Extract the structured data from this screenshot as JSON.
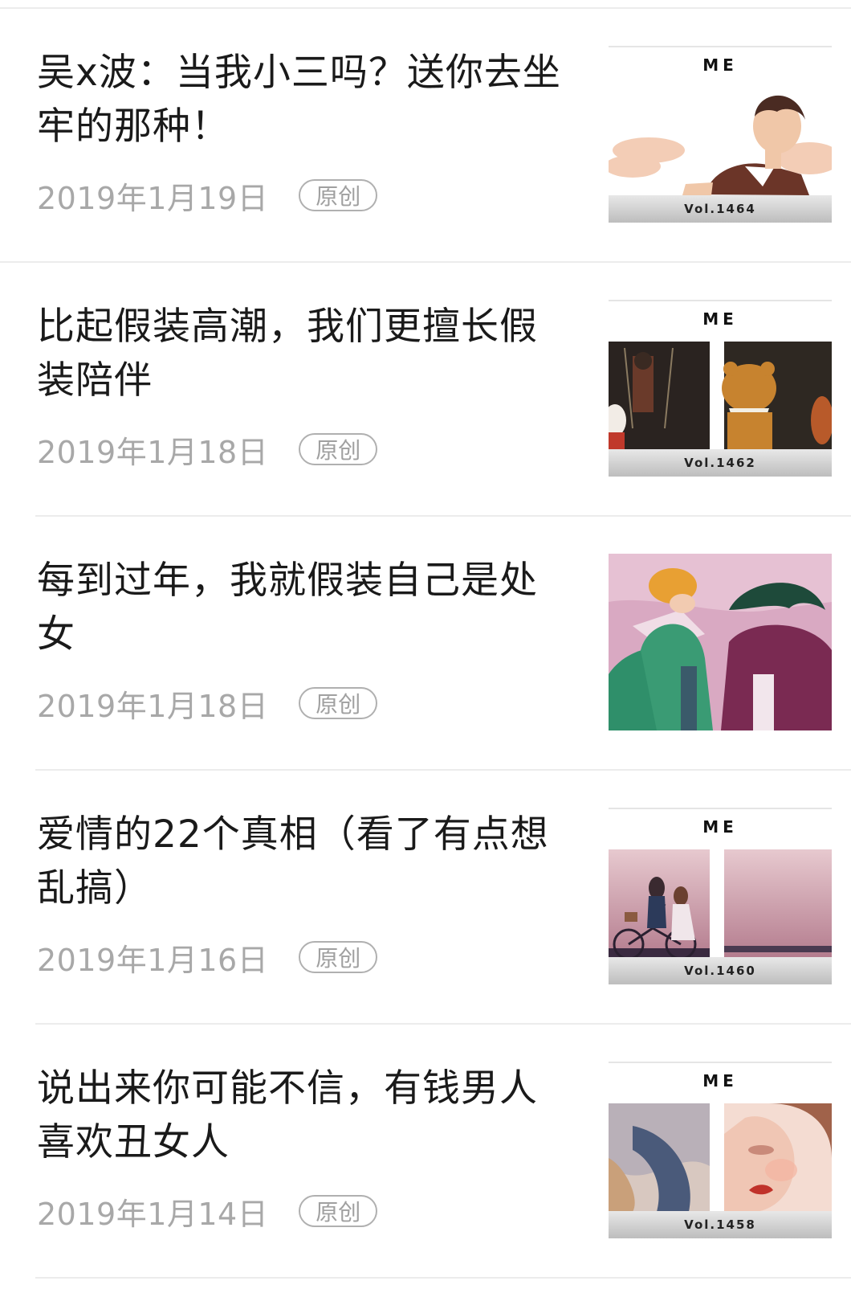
{
  "articles": [
    {
      "title": "吴x波：当我小三吗？送你去坐牢的那种！",
      "date": "2019年1月19日",
      "badge": "原创",
      "thumb_brand": "ME",
      "thumb_vol": "Vol.1464"
    },
    {
      "title": "比起假装高潮，我们更擅长假装陪伴",
      "date": "2019年1月18日",
      "badge": "原创",
      "thumb_brand": "ME",
      "thumb_vol": "Vol.1462"
    },
    {
      "title": "每到过年，我就假装自己是处女",
      "date": "2019年1月18日",
      "badge": "原创"
    },
    {
      "title": "爱情的22个真相（看了有点想乱搞）",
      "date": "2019年1月16日",
      "badge": "原创",
      "thumb_brand": "ME",
      "thumb_vol": "Vol.1460"
    },
    {
      "title": "说出来你可能不信，有钱男人喜欢丑女人",
      "date": "2019年1月14日",
      "badge": "原创",
      "thumb_brand": "ME",
      "thumb_vol": "Vol.1458"
    }
  ]
}
